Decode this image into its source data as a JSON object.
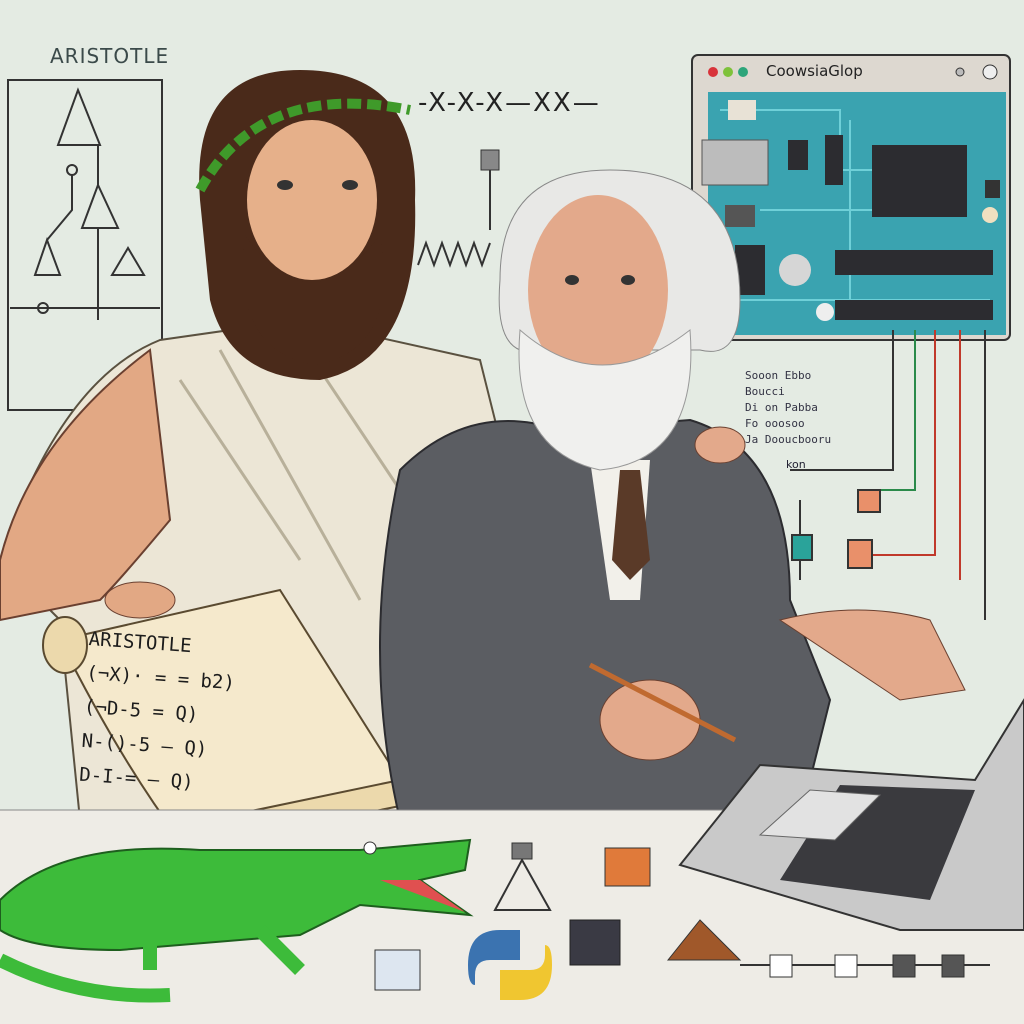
{
  "diagram_title": "ARISTOTLE",
  "top_formula": "-X-X-X—XX—",
  "window": {
    "title": "CoowsiaGlop"
  },
  "scroll": {
    "heading": "ARISTOTLE",
    "lines": [
      "(¬X)· = = b2)",
      "(¬D-5 = Q)",
      "N-()-5 — Q)",
      "D-I-= — Q)"
    ]
  },
  "board_notes": {
    "lines": [
      "Sooon    Ebbo",
      "Boucci",
      "Di on Pabba",
      "Fo ooosoo",
      "Ja Dooucbooru"
    ],
    "wire_label": "kon"
  },
  "colors": {
    "background": "#e4ebe3",
    "board": "#3aa3b0",
    "crocodile": "#3dbb3a",
    "suit": "#5b5d62"
  }
}
